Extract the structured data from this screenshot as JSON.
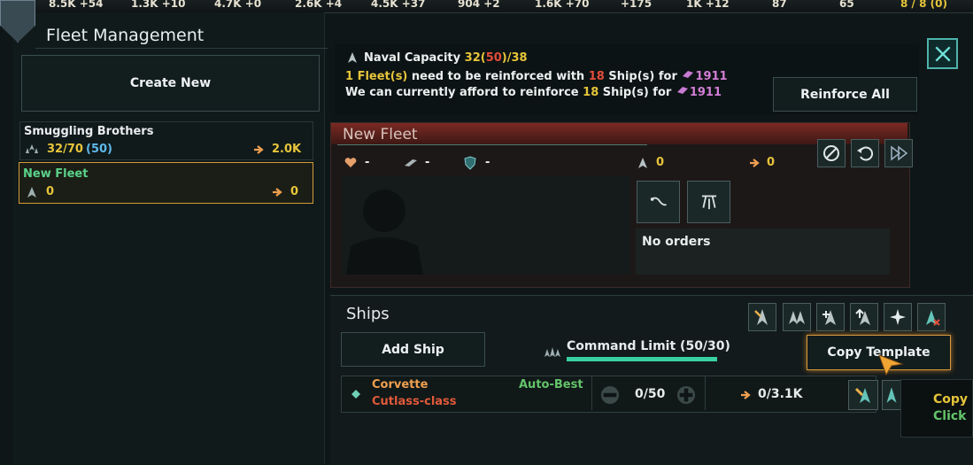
{
  "resources": [
    "8.5K +54",
    "1.3K +10",
    "4.7K +0",
    "2.6K +4",
    "4.5K +37",
    "904 +2",
    "1.6K +70",
    "+175",
    "1K +12",
    "87",
    "65",
    "8 / 8 (0)"
  ],
  "left": {
    "title": "Fleet Management",
    "create_new": "Create New",
    "fleets": [
      {
        "name": "Smuggling Brothers",
        "strength": "32/70",
        "strength_paren": "(50)",
        "power": "2.0K"
      },
      {
        "name": "New Fleet",
        "strength": "0",
        "power": "0"
      }
    ]
  },
  "capacity": {
    "label": "Naval Capacity",
    "used": "32",
    "open_paren": "(",
    "queued": "50",
    "close_max": ")/38",
    "line1_count": "1 Fleet(s)",
    "line1_mid": "need to be reinforced with",
    "line1_ships": "18",
    "line1_ships_suffix": "Ship(s) for",
    "line1_cost": "1911",
    "line2_prefix": "We can currently afford to reinforce",
    "line2_ships": "18",
    "line2_ships_suffix": "Ship(s) for",
    "line2_cost": "1911",
    "reinforce_all": "Reinforce All"
  },
  "fleet": {
    "name": "New Fleet",
    "hull": "-",
    "armor": "-",
    "shield": "-",
    "ships": "0",
    "power": "0",
    "orders": "No orders"
  },
  "ships": {
    "title": "Ships",
    "add_ship": "Add Ship",
    "command_limit": "Command Limit (50/30)",
    "copy_template": "Copy Template",
    "row": {
      "class": "Corvette",
      "design": "Cutlass-class",
      "mode": "Auto-Best",
      "count": "0/50",
      "power": "0/3.1K"
    }
  },
  "tooltip": {
    "line1": "Copy",
    "line2": "Click"
  },
  "colors": {
    "gold": "#e6c53a",
    "orange": "#f0a050",
    "green": "#63c46a",
    "red": "#e34d3a"
  }
}
